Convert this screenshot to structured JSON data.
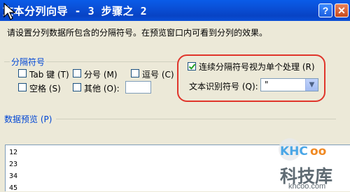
{
  "window": {
    "title": "文本分列向导 - 3 步骤之 2",
    "help_label": "?",
    "close_label": "✕"
  },
  "instruction": "请设置分列数据所包含的分隔符号。在预览窗口内可看到分列的效果。",
  "delimiters": {
    "group_label": "分隔符号",
    "tab": {
      "label": "Tab 键 (T)",
      "checked": false
    },
    "semicolon": {
      "label": "分号 (M)",
      "checked": false
    },
    "comma": {
      "label": "逗号 (C)",
      "checked": false
    },
    "space": {
      "label": "空格 (S)",
      "checked": false
    },
    "other": {
      "label": "其他 (O):",
      "checked": false,
      "value": ""
    }
  },
  "consecutive": {
    "label": "连续分隔符号视为单个处理 (R)",
    "checked": true
  },
  "text_qualifier": {
    "label": "文本识别符号 (Q):",
    "value": "\""
  },
  "preview": {
    "label": "数据预览 (P)",
    "rows": [
      "12",
      "23",
      "34",
      "45"
    ]
  },
  "watermark": {
    "logo": "KHCoo",
    "text": "科技库",
    "url": "khcoo.com"
  }
}
